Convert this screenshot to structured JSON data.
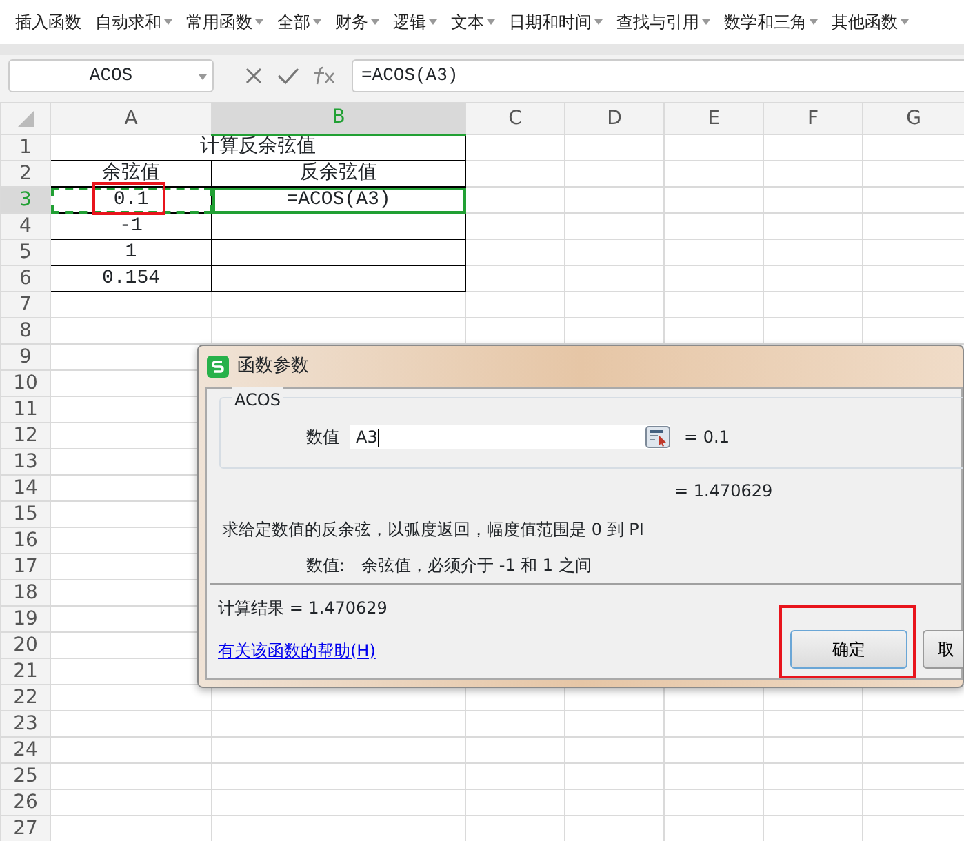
{
  "toolbar": [
    {
      "label": "插入函数",
      "dropdown": false
    },
    {
      "label": "自动求和",
      "dropdown": true
    },
    {
      "label": "常用函数",
      "dropdown": true
    },
    {
      "label": "全部",
      "dropdown": true
    },
    {
      "label": "财务",
      "dropdown": true
    },
    {
      "label": "逻辑",
      "dropdown": true
    },
    {
      "label": "文本",
      "dropdown": true
    },
    {
      "label": "日期和时间",
      "dropdown": true
    },
    {
      "label": "查找与引用",
      "dropdown": true
    },
    {
      "label": "数学和三角",
      "dropdown": true
    },
    {
      "label": "其他函数",
      "dropdown": true
    }
  ],
  "name_box": {
    "value": "ACOS"
  },
  "formula_bar": {
    "value": "=ACOS(A3)"
  },
  "columns": [
    {
      "label": "A",
      "selected": false
    },
    {
      "label": "B",
      "selected": true
    },
    {
      "label": "C",
      "selected": false
    },
    {
      "label": "D",
      "selected": false
    },
    {
      "label": "E",
      "selected": false
    },
    {
      "label": "F",
      "selected": false
    },
    {
      "label": "G",
      "selected": false
    }
  ],
  "rows": [
    {
      "label": "1",
      "selected": false,
      "cells": [
        {
          "text": "计算反余弦值",
          "selected": false,
          "marquee": false,
          "highlighted": false
        }
      ]
    },
    {
      "label": "2",
      "selected": false,
      "cells": [
        {
          "text": "余弦值",
          "selected": false,
          "marquee": false,
          "highlighted": false
        },
        {
          "text": "反余弦值",
          "selected": false,
          "marquee": false,
          "highlighted": false
        }
      ]
    },
    {
      "label": "3",
      "selected": true,
      "cells": [
        {
          "text": "0.1",
          "selected": false,
          "marquee": true,
          "highlighted": true
        },
        {
          "text": "=ACOS(A3)",
          "selected": true,
          "marquee": false,
          "highlighted": false
        }
      ]
    },
    {
      "label": "4",
      "selected": false,
      "cells": [
        {
          "text": "-1",
          "selected": false,
          "marquee": false,
          "highlighted": false
        },
        {
          "selected": false,
          "marquee": false,
          "highlighted": false
        }
      ]
    },
    {
      "label": "5",
      "selected": false,
      "cells": [
        {
          "text": "1",
          "selected": false,
          "marquee": false,
          "highlighted": false
        },
        {
          "selected": false,
          "marquee": false,
          "highlighted": false
        }
      ]
    },
    {
      "label": "6",
      "selected": false,
      "cells": [
        {
          "text": "0.154",
          "selected": false,
          "marquee": false,
          "highlighted": false
        },
        {
          "selected": false,
          "marquee": false,
          "highlighted": false
        }
      ]
    },
    {
      "label": "7",
      "selected": false
    },
    {
      "label": "8",
      "selected": false
    },
    {
      "label": "9",
      "selected": false
    },
    {
      "label": "10",
      "selected": false
    },
    {
      "label": "11",
      "selected": false
    },
    {
      "label": "12",
      "selected": false
    },
    {
      "label": "13",
      "selected": false
    },
    {
      "label": "14",
      "selected": false
    },
    {
      "label": "15",
      "selected": false
    },
    {
      "label": "16",
      "selected": false
    },
    {
      "label": "17",
      "selected": false
    },
    {
      "label": "18",
      "selected": false
    },
    {
      "label": "19",
      "selected": false
    },
    {
      "label": "20",
      "selected": false
    },
    {
      "label": "21",
      "selected": false
    },
    {
      "label": "22",
      "selected": false
    },
    {
      "label": "23",
      "selected": false
    },
    {
      "label": "24",
      "selected": false
    },
    {
      "label": "25",
      "selected": false
    },
    {
      "label": "26",
      "selected": false
    },
    {
      "label": "27",
      "selected": false
    }
  ],
  "dialog": {
    "title": "函数参数",
    "function_name": "ACOS",
    "arguments": [
      {
        "label": "数值",
        "value": "A3",
        "result": "= 0.1"
      }
    ],
    "formula_result": "= 1.470629",
    "description": "求给定数值的反余弦，以弧度返回，幅度值范围是 0 到 PI",
    "argument_help": {
      "label": "数值:",
      "text": "余弦值，必须介于 -1 和 1 之间"
    },
    "result": "计算结果 = 1.470629",
    "help_link": "有关该函数的帮助(H)",
    "buttons": [
      {
        "label": "确定",
        "highlighted": true
      },
      {
        "label": "取",
        "highlighted": false
      }
    ]
  }
}
